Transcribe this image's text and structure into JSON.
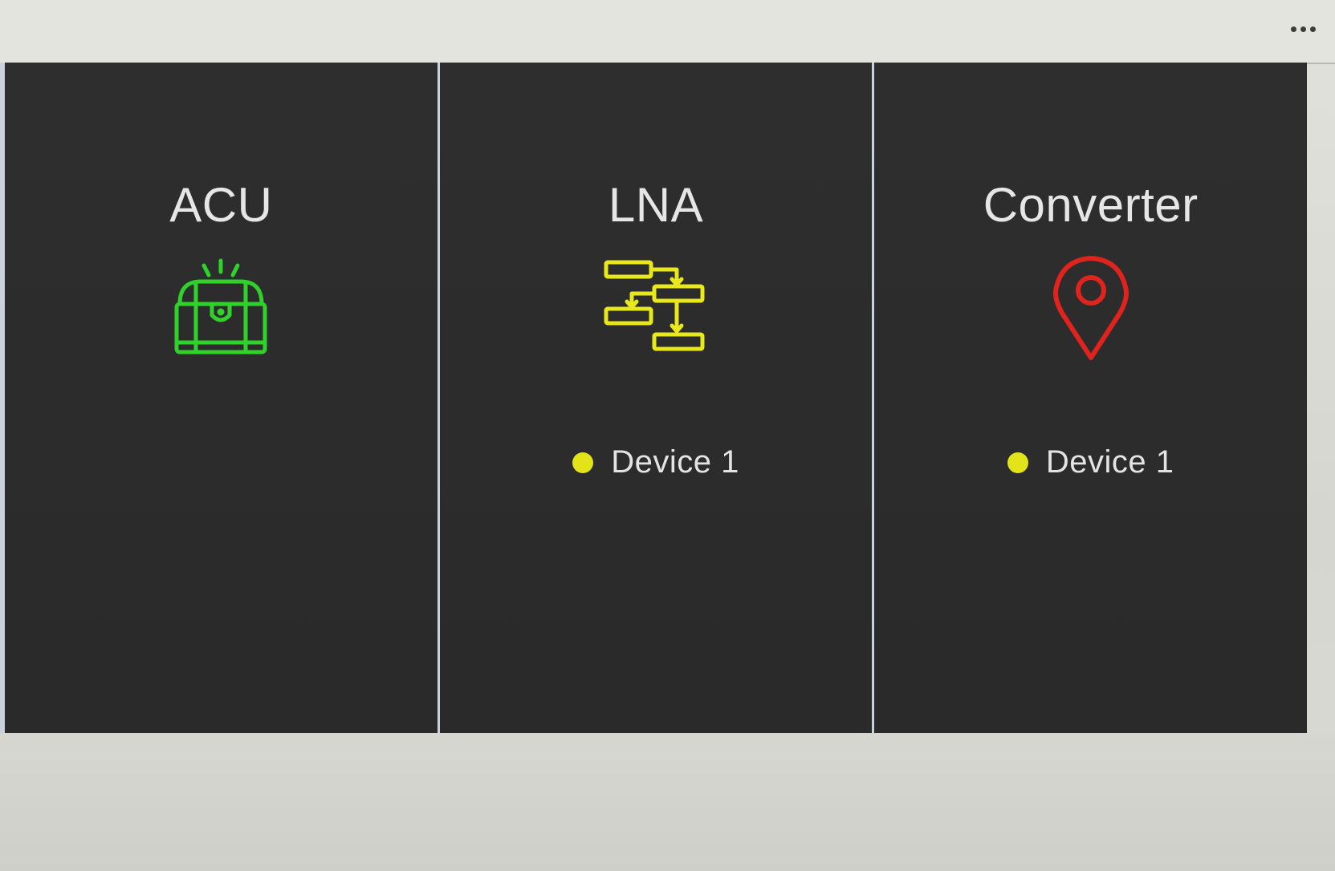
{
  "toolbar": {
    "more_icon": "more-horizontal-icon"
  },
  "tiles": [
    {
      "title": "ACU",
      "icon": "treasure-chest-icon",
      "icon_color": "#2fd12a",
      "device": null
    },
    {
      "title": "LNA",
      "icon": "flowchart-icon",
      "icon_color": "#e8e81c",
      "device": {
        "label": "Device 1",
        "status_color": "#e3e31a"
      }
    },
    {
      "title": "Converter",
      "icon": "map-pin-icon",
      "icon_color": "#e0231c",
      "device": {
        "label": "Device 1",
        "status_color": "#e3e31a"
      }
    }
  ]
}
